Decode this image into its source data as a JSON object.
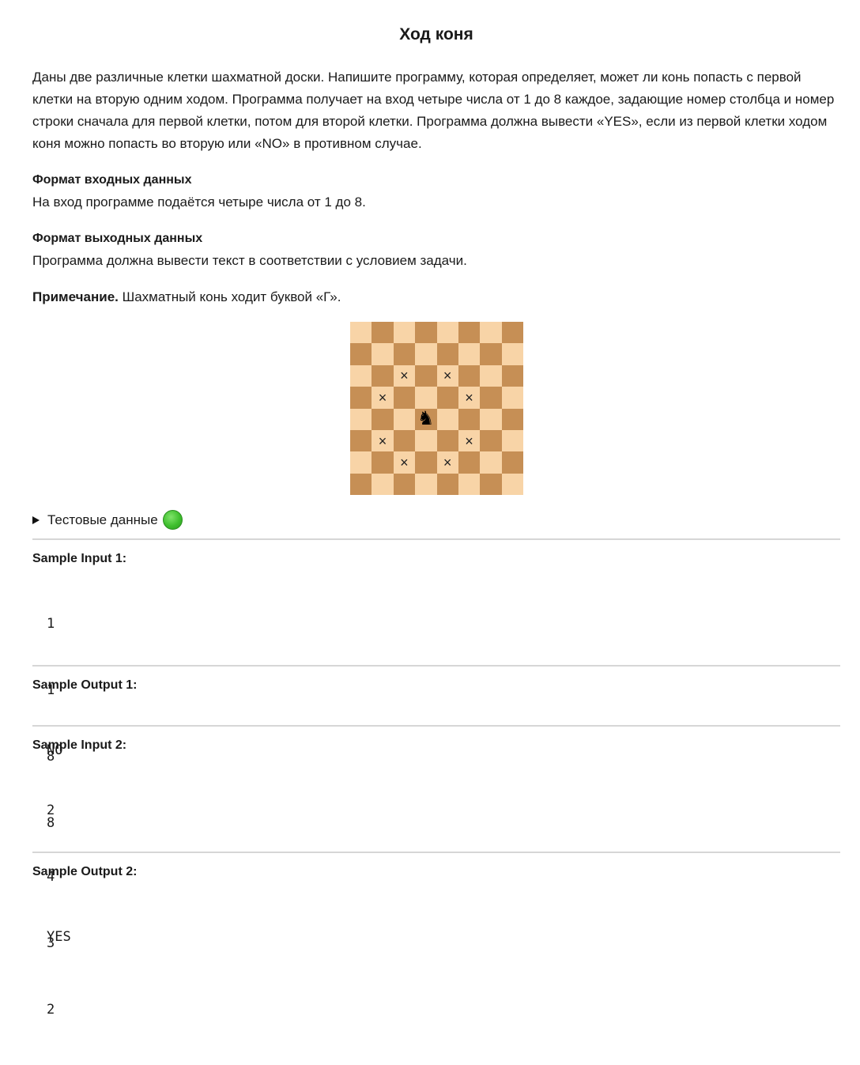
{
  "problem": {
    "title": "Ход коня",
    "intro": "Даны две различные клетки шахматной доски. Напишите программу,  которая определяет, может ли конь попасть с первой клетки на вторую одним ходом. Программа получает на вход четыре числа от 1 до 8 каждое, задающие номер столбца и номер строки сначала для первой клетки, потом для второй клетки. Программа должна вывести «YES», если из первой клетки ходом коня можно попасть во вторую или «NO» в противном случае.",
    "input_format_title": "Формат входных данных",
    "input_format_text": "На вход программе подаётся четыре числа от 1 до 8.",
    "output_format_title": "Формат выходных данных",
    "output_format_text": "Программа должна вывести текст в соответствии с условием задачи.",
    "note_label": "Примечание.",
    "note_text": " Шахматный конь ходит буквой «Г»."
  },
  "board": {
    "light_color": "#f8d4a7",
    "dark_color": "#c68f55",
    "knight_symbol": "♞",
    "knight_icon": "chess-knight-icon",
    "mark_symbol": "×",
    "mark_icon": "cross-icon"
  },
  "tests": {
    "summary_label": "Тестовые данные",
    "status_icon": "green-circle-icon",
    "status_color": "#3fbf2e"
  },
  "samples": [
    {
      "title": "Sample Input 1:",
      "lines": [
        "1",
        "1",
        "8",
        "8"
      ]
    },
    {
      "title": "Sample Output 1:",
      "lines": [
        "NO"
      ]
    },
    {
      "title": "Sample Input 2:",
      "lines": [
        "2",
        "4",
        "3",
        "2"
      ]
    },
    {
      "title": "Sample Output 2:",
      "lines": [
        "YES"
      ]
    }
  ]
}
